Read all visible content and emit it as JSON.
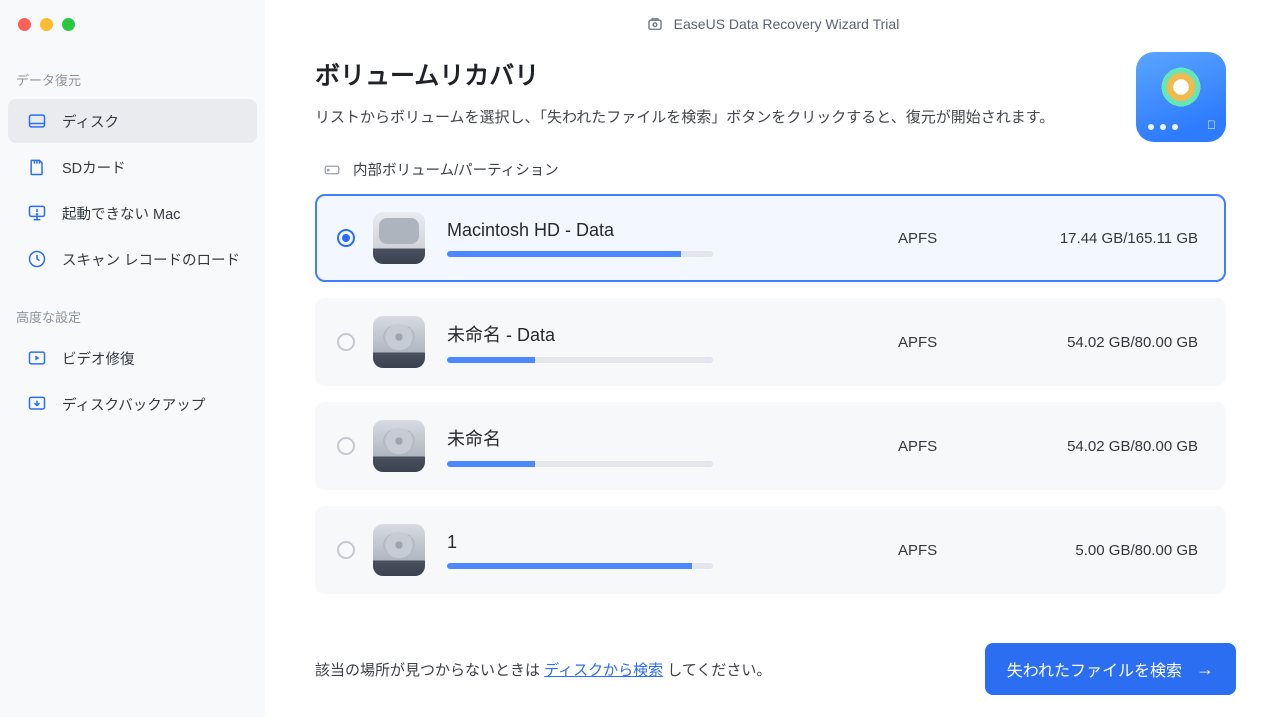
{
  "appTitle": "EaseUS Data Recovery Wizard  Trial",
  "sidebar": {
    "section1Label": "データ復元",
    "section2Label": "高度な設定",
    "items": [
      {
        "label": "ディスク"
      },
      {
        "label": "SDカード"
      },
      {
        "label": "起動できない Mac"
      },
      {
        "label": "スキャン レコードのロード"
      }
    ],
    "adv": [
      {
        "label": "ビデオ修復"
      },
      {
        "label": "ディスクバックアップ"
      }
    ]
  },
  "page": {
    "title": "ボリュームリカバリ",
    "desc": "リストからボリュームを選択し、「失われたファイルを検索」ボタンをクリックすると、復元が開始されます。"
  },
  "group": {
    "label": "内部ボリューム/パーティション"
  },
  "volumes": [
    {
      "name": "Macintosh HD - Data",
      "type": "APFS",
      "size": "17.44 GB/165.11 GB",
      "pct": 88
    },
    {
      "name": "未命名 - Data",
      "type": "APFS",
      "size": "54.02 GB/80.00 GB",
      "pct": 33
    },
    {
      "name": "未命名",
      "type": "APFS",
      "size": "54.02 GB/80.00 GB",
      "pct": 33
    },
    {
      "name": "1",
      "type": "APFS",
      "size": "5.00 GB/80.00 GB",
      "pct": 92
    }
  ],
  "footer": {
    "prefix": "該当の場所が見つからないときは ",
    "link": "ディスクから検索",
    "suffix": " してください。"
  },
  "scanBtn": "失われたファイルを検索"
}
